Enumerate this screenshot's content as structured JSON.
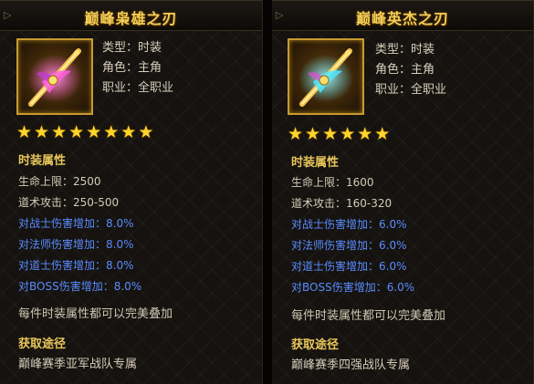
{
  "items": [
    {
      "title": "巅峰枭雄之刃",
      "type_label": "类型：时装",
      "role_label": "角色：主角",
      "class_label": "职业：全职业",
      "star_count": 8,
      "attr_section_title": "时装属性",
      "attrs_white": [
        "生命上限：2500",
        "道术攻击：250-500"
      ],
      "attrs_blue": [
        "对战士伤害增加：8.0%",
        "对法师伤害增加：8.0%",
        "对道士伤害增加：8.0%",
        "对BOSS伤害增加：8.0%"
      ],
      "stack_note": "每件时装属性都可以完美叠加",
      "source_title": "获取途径",
      "source_text": "巅峰赛季亚军战队专属",
      "icon": "magenta-sword-icon",
      "glow_color": "#ff4fd8"
    },
    {
      "title": "巅峰英杰之刃",
      "type_label": "类型：时装",
      "role_label": "角色：主角",
      "class_label": "职业：全职业",
      "star_count": 6,
      "attr_section_title": "时装属性",
      "attrs_white": [
        "生命上限：1600",
        "道术攻击：160-320"
      ],
      "attrs_blue": [
        "对战士伤害增加：6.0%",
        "对法师伤害增加：6.0%",
        "对道士伤害增加：6.0%",
        "对BOSS伤害增加：6.0%"
      ],
      "stack_note": "每件时装属性都可以完美叠加",
      "source_title": "获取途径",
      "source_text": "巅峰赛季四强战队专属",
      "icon": "cyan-sword-icon",
      "glow_color": "#49e0ff"
    }
  ],
  "colors": {
    "title_gold": "#f3cf58",
    "section_gold": "#e8c65a",
    "attr_blue": "#5a8cff",
    "star_yellow": "#ffd52a"
  }
}
